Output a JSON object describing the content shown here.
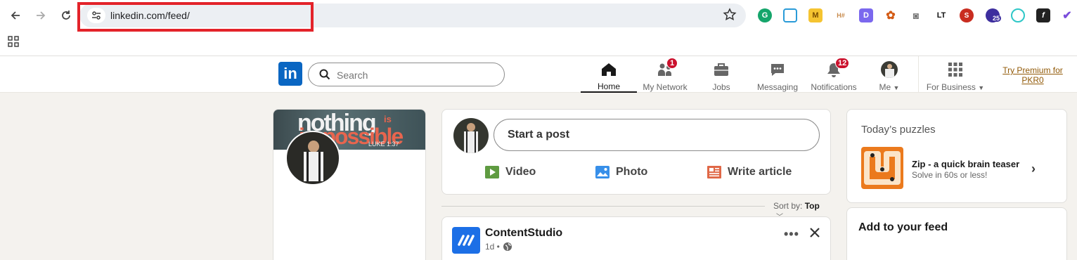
{
  "browser": {
    "url": "linkedin.com/feed/",
    "extensions": [
      "grammarly-icon",
      "screenshot-icon",
      "m-icon",
      "hashtag-icon",
      "d-icon",
      "flower-icon",
      "camera-icon",
      "lt-icon",
      "seo-icon",
      "graduation-icon",
      "smile-icon",
      "f-icon",
      "check-icon"
    ],
    "extension_badge": "25"
  },
  "header": {
    "logo_text": "in",
    "search_placeholder": "Search",
    "nav": {
      "home": "Home",
      "network": "My Network",
      "network_badge": "1",
      "jobs": "Jobs",
      "messaging": "Messaging",
      "notifications": "Notifications",
      "notifications_badge": "12",
      "me": "Me",
      "business": "For Business"
    },
    "premium": "Try Premium for PKR0"
  },
  "profile": {
    "banner_line1": "nothing",
    "banner_is": "is",
    "banner_line2": "impossible",
    "banner_ref": "LUKE 1:37"
  },
  "composer": {
    "start_post": "Start a post",
    "video": "Video",
    "photo": "Photo",
    "article": "Write article"
  },
  "sort": {
    "label": "Sort by:",
    "value": "Top"
  },
  "feed_post": {
    "author": "ContentStudio",
    "time": "1d •"
  },
  "puzzles": {
    "title": "Today’s puzzles",
    "game_name": "Zip - a quick brain teaser",
    "game_sub": "Solve in 60s or less!"
  },
  "add_feed": {
    "title": "Add to your feed"
  }
}
